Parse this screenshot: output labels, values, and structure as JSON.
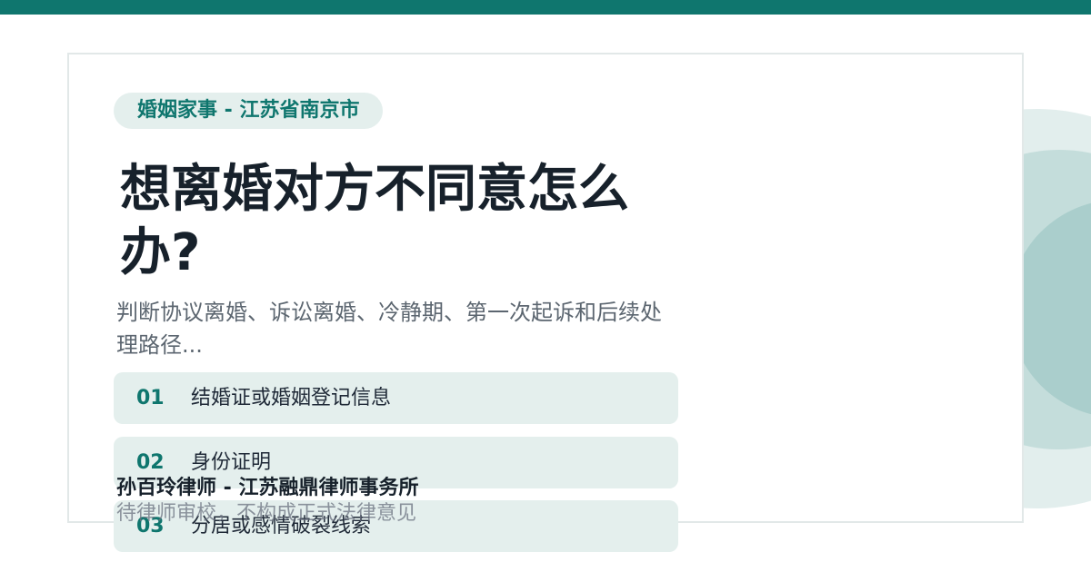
{
  "category": "婚姻家事 - 江苏省南京市",
  "title": "想离婚对方不同意怎么办?",
  "subtitle": "判断协议离婚、诉讼离婚、冷静期、第一次起诉和后续处理路径...",
  "items": [
    {
      "num": "01",
      "text": "结婚证或婚姻登记信息"
    },
    {
      "num": "02",
      "text": "身份证明"
    },
    {
      "num": "03",
      "text": "分居或感情破裂线索"
    }
  ],
  "author": "孙百玲律师 - 江苏融鼎律师事务所",
  "note": "待律师审校，不构成正式法律意见",
  "colors": {
    "accent": "#0f766e",
    "chip_bg": "#e4efed",
    "title": "#17212b"
  }
}
